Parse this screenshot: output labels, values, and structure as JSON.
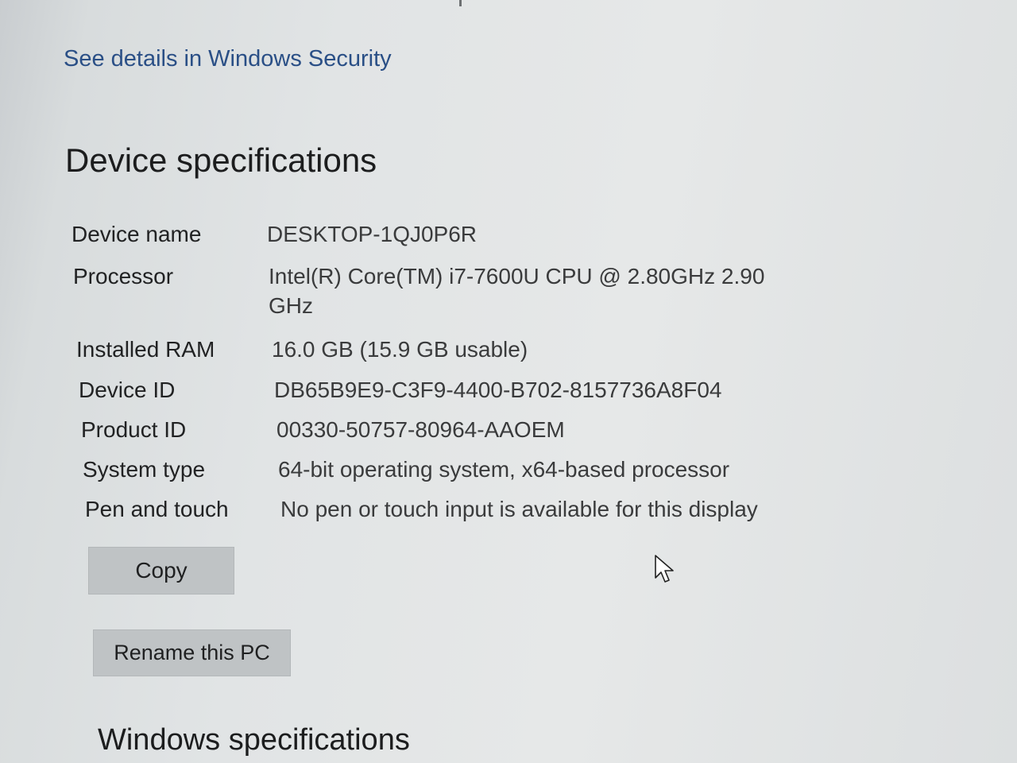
{
  "security_link": "See details in Windows Security",
  "device_specs": {
    "heading": "Device specifications",
    "rows": [
      {
        "label": "Device name",
        "value": "DESKTOP-1QJ0P6R"
      },
      {
        "label": "Processor",
        "value": "Intel(R) Core(TM) i7-7600U CPU @ 2.80GHz   2.90 GHz"
      },
      {
        "label": "Installed RAM",
        "value": "16.0 GB (15.9 GB usable)"
      },
      {
        "label": "Device ID",
        "value": "DB65B9E9-C3F9-4400-B702-8157736A8F04"
      },
      {
        "label": "Product ID",
        "value": "00330-50757-80964-AAOEM"
      },
      {
        "label": "System type",
        "value": "64-bit operating system, x64-based processor"
      },
      {
        "label": "Pen and touch",
        "value": "No pen or touch input is available for this display"
      }
    ],
    "copy_label": "Copy",
    "rename_label": "Rename this PC"
  },
  "windows_specs": {
    "heading": "Windows specifications"
  },
  "colors": {
    "link": "#2a4f86",
    "button_bg": "#bfc3c5",
    "background": "#e1e4e5"
  },
  "icons": {
    "cursor": "mouse-pointer-icon"
  }
}
